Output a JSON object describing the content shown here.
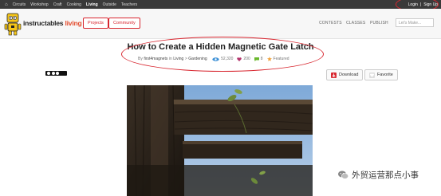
{
  "topbar": {
    "nav": [
      "Circuits",
      "Workshop",
      "Craft",
      "Cooking",
      "Living",
      "Outside",
      "Teachers"
    ],
    "active": "Living",
    "login": "Login",
    "separator": "|",
    "signup": "Sign Up"
  },
  "header": {
    "brand_prefix": "instructables",
    "brand_accent": "living",
    "projects_label": "Projects",
    "community_label": "Community",
    "contests_label": "CONTESTS",
    "classes_label": "CLASSES",
    "publish_label": "PUBLISH",
    "search_placeholder": "Let's Make..."
  },
  "article": {
    "title": "How to Create a Hidden Magnetic Gate Latch",
    "by": "By",
    "author": "first4magnets",
    "in": "in",
    "category": "Living",
    "arrow": ">",
    "subcategory": "Gardening",
    "views": "52,320",
    "favorites": "200",
    "comments": "8",
    "featured": "Featured"
  },
  "actions": {
    "download_label": "Download",
    "favorite_label": "Favorite"
  },
  "watermark": {
    "text": "外贸运营那点小事"
  },
  "colors": {
    "accent_red": "#d8262f",
    "brand_orange": "#e3492a",
    "view_blue": "#3b8fd6",
    "heart_purple": "#b3336b",
    "comment_green": "#6ab82c",
    "featured_orange": "#f0a23b"
  }
}
